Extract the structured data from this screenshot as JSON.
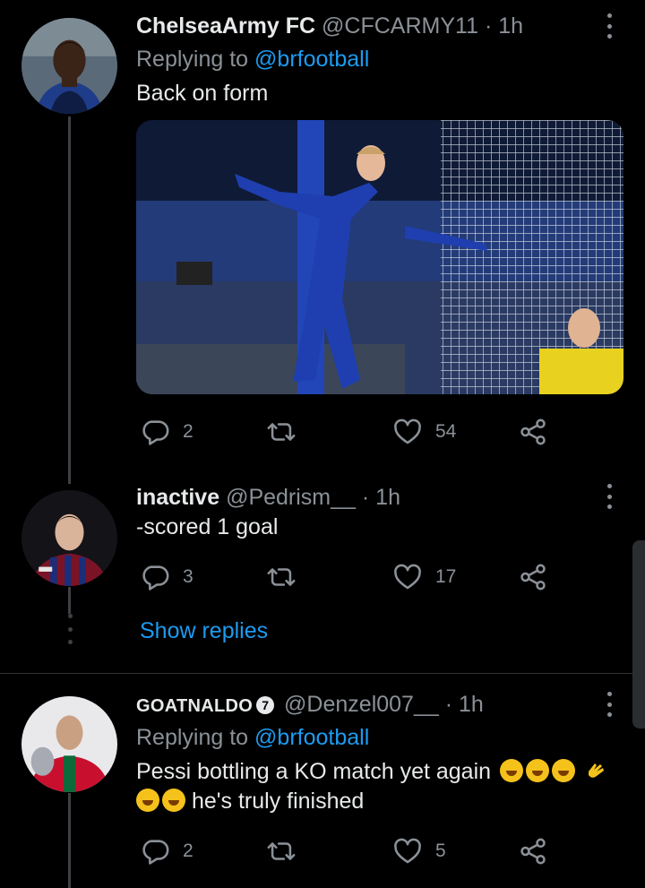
{
  "tweets": [
    {
      "name": "ChelseaArmy FC",
      "handle": "@CFCARMY11",
      "separator": "·",
      "time": "1h",
      "replying_label": "Replying to",
      "replying_to": "@brfootball",
      "text": "Back on form",
      "replies": "2",
      "likes": "54"
    },
    {
      "name": "inactive",
      "handle": "@Pedrism__",
      "separator": "·",
      "time": "1h",
      "text": "-scored 1 goal",
      "replies": "3",
      "likes": "17"
    },
    {
      "name": "GOATNALDO",
      "badge": "7",
      "handle": "@Denzel007__",
      "separator": "·",
      "time": "1h",
      "replying_label": "Replying to",
      "replying_to": "@brfootball",
      "text_line1": "Pessi bottling a KO match yet again",
      "text_line2": "he's truly finished",
      "replies": "2",
      "likes": "5"
    }
  ],
  "show_replies": "Show replies",
  "icons": {
    "reply": "reply-icon",
    "retweet": "retweet-icon",
    "like": "heart-icon",
    "share": "share-icon",
    "more": "more-icon"
  },
  "colors": {
    "background": "#000000",
    "text": "#e7e9ea",
    "secondary": "#8b9197",
    "link": "#1d9bf0",
    "thread": "#3d4044"
  }
}
